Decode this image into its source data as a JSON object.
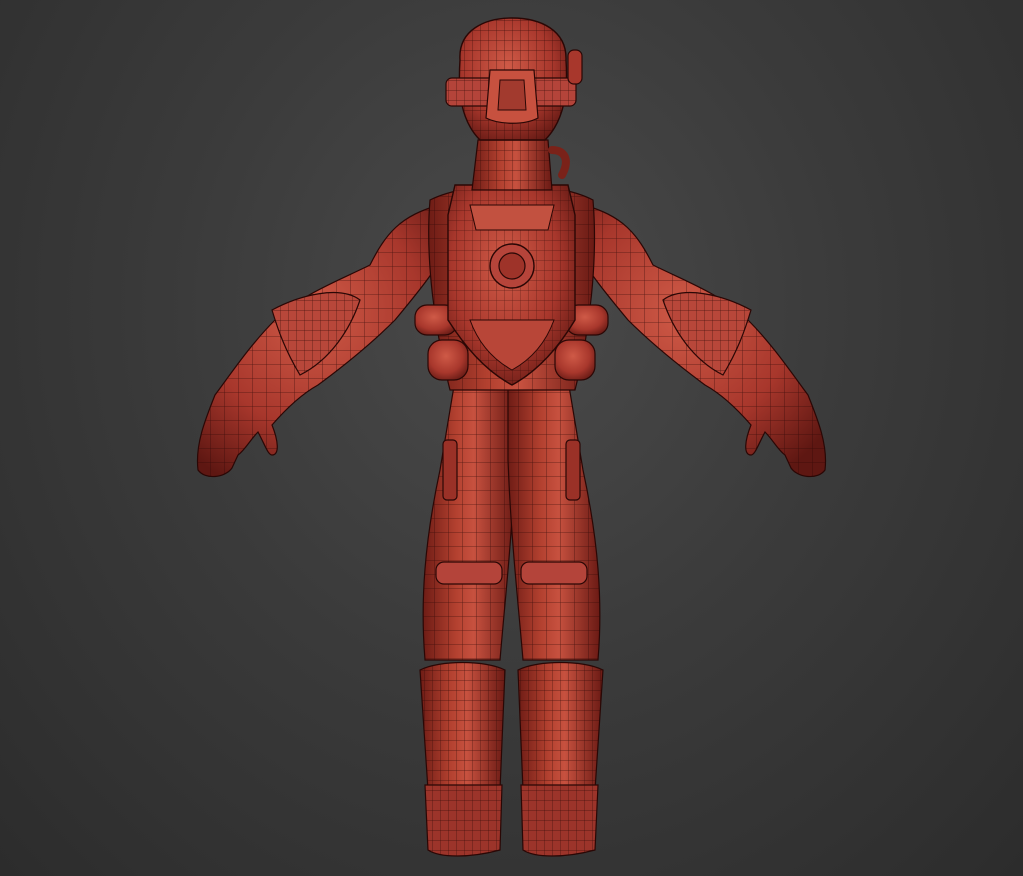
{
  "viewport": {
    "background_top": "#4a4a4a",
    "background_bottom": "#2c2c2c"
  },
  "model": {
    "subject": "character-back-view-wireframe",
    "base_color": "#a8372c",
    "highlight_color": "#cf5a47",
    "shadow_color": "#5e1712",
    "wire_color": "#2a0705"
  }
}
